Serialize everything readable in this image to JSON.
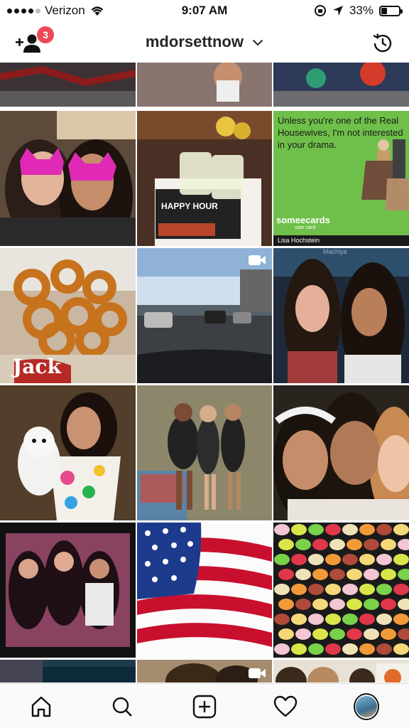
{
  "status_bar": {
    "carrier": "Verizon",
    "time": "9:07 AM",
    "battery": "33%",
    "battery_level": 0.33,
    "icons": [
      "signal-icon",
      "wifi-icon",
      "orientation-lock-icon",
      "location-icon",
      "battery-icon"
    ]
  },
  "header": {
    "username": "mdorsettnow",
    "notification_count": "3",
    "icons": [
      "add-user-icon",
      "chevron-down-icon",
      "history-icon"
    ]
  },
  "tiles": {
    "sign_text": "Unless you're one of the Real Housewives, I'm not interested in your drama.",
    "sign_brand": "someecards",
    "sign_brand_sub": "user card",
    "sign_author": "Lisa Hochstein",
    "happy_hour": "HAPPY HOUR",
    "jack": "Jack",
    "overlay_name": "Machiya"
  },
  "tab_bar": {
    "items": [
      "home-icon",
      "search-icon",
      "new-post-icon",
      "activity-heart-icon",
      "profile-avatar"
    ]
  },
  "colors": {
    "badge": "#ed4956",
    "tabbar_bg": "#fafafa",
    "sign_green": "#6fc04a"
  }
}
